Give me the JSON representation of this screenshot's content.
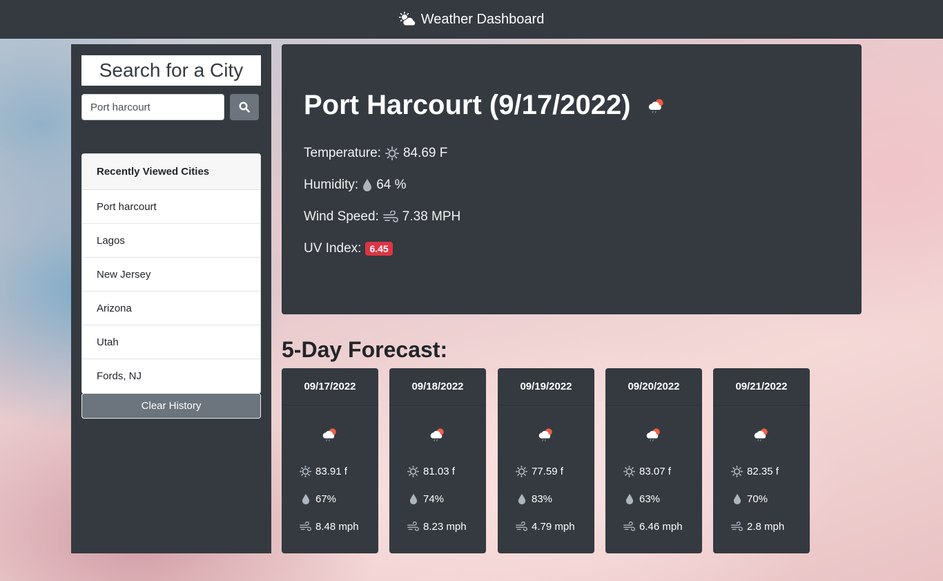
{
  "app": {
    "title": "Weather Dashboard",
    "brand_icon": "cloud-sun-icon"
  },
  "search": {
    "title": "Search for a City",
    "input_value": "Port harcourt",
    "button_icon": "search-icon"
  },
  "history": {
    "header": "Recently Viewed Cities",
    "items": [
      "Port harcourt",
      "Lagos",
      "New Jersey",
      "Arizona",
      "Utah",
      "Fords, NJ"
    ],
    "clear_label": "Clear History"
  },
  "current": {
    "title": "Port Harcourt (9/17/2022)",
    "weather_icon": "cloud-sun-rain-icon",
    "temperature_label": "Temperature:",
    "temperature_value": "84.69 F",
    "humidity_label": "Humidity:",
    "humidity_value": "64 %",
    "wind_label": "Wind Speed:",
    "wind_value": "7.38 MPH",
    "uv_label": "UV Index:",
    "uv_value": "6.45",
    "uv_color": "#dc3545"
  },
  "forecast": {
    "heading": "5-Day Forecast:",
    "days": [
      {
        "date": "09/17/2022",
        "temp": "83.91 f",
        "humidity": "67%",
        "wind": "8.48 mph"
      },
      {
        "date": "09/18/2022",
        "temp": "81.03 f",
        "humidity": "74%",
        "wind": "8.23 mph"
      },
      {
        "date": "09/19/2022",
        "temp": "77.59 f",
        "humidity": "83%",
        "wind": "4.79 mph"
      },
      {
        "date": "09/20/2022",
        "temp": "83.07 f",
        "humidity": "63%",
        "wind": "6.46 mph"
      },
      {
        "date": "09/21/2022",
        "temp": "82.35 f",
        "humidity": "70%",
        "wind": "2.8 mph"
      }
    ]
  },
  "colors": {
    "panel": "#343a40",
    "button_grey": "#6c757d",
    "icon_grey": "#adb5bd",
    "sun_orange": "#f15d46"
  }
}
